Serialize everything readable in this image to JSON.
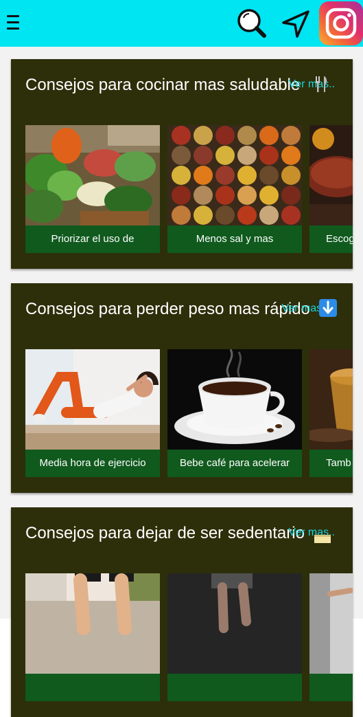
{
  "topbar": {
    "background": "#00e5f2",
    "icons": [
      "menu-icon",
      "search-icon",
      "navigation-arrow-icon",
      "instagram-icon"
    ]
  },
  "sections": [
    {
      "title": "Consejos para cocinar mas saludable",
      "more": "Ver mas..",
      "emoji": "fork-knife-icon",
      "cards": [
        {
          "label": "Priorizar el uso de"
        },
        {
          "label": "Menos sal y mas"
        },
        {
          "label": "Escog"
        }
      ]
    },
    {
      "title": "Consejos para perder peso mas rápido",
      "more": "Ver mas..",
      "emoji": "down-arrow-icon",
      "cards": [
        {
          "label": "Media hora de ejercicio"
        },
        {
          "label": "Bebe café para acelerar"
        },
        {
          "label": "Tamb"
        }
      ]
    },
    {
      "title": "Consejos para dejar de ser sedentario",
      "more": "Ver mas..",
      "emoji": "notepad-icon",
      "cards": [
        {
          "label": ""
        },
        {
          "label": ""
        },
        {
          "label": ""
        }
      ]
    }
  ],
  "colors": {
    "section_bg": "#2d2f0a",
    "card_caption_bg": "#105a1e",
    "link": "#18d4dd"
  }
}
